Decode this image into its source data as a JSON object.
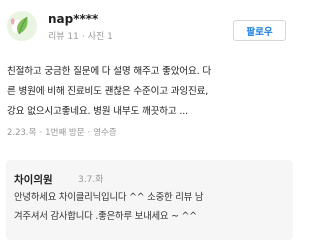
{
  "review": {
    "user": {
      "name": "nap****",
      "review_count": "리뷰 11",
      "photo_count": "사진 1",
      "avatar_icon": "leaf-avatar-icon"
    },
    "follow_label": "팔로우",
    "text_lines": [
      "친절하고 궁금한 질문에 다 설명 해주고 좋았어요. 다",
      "른 병원에 비해 진료비도 괜찮은 수준이고 과잉진료,",
      "강요 없으시고좋네요. 병원 내부도 깨끗하고 ..."
    ],
    "meta": {
      "date": "2.23.목",
      "visit": "1번째 방문",
      "proof": "영수증"
    }
  },
  "reply": {
    "name": "차이의원",
    "date": "3.7.화",
    "text_lines": [
      "안녕하세요 차이클리닉입니다 ^^ 소중한 리뷰 남",
      "겨주셔서 감사합니다 .좋은하루 보내세요 ~ ^^"
    ]
  },
  "colors": {
    "accent": "#1b7fe0",
    "muted": "#999999",
    "reply_background": "#f6f6f6"
  }
}
